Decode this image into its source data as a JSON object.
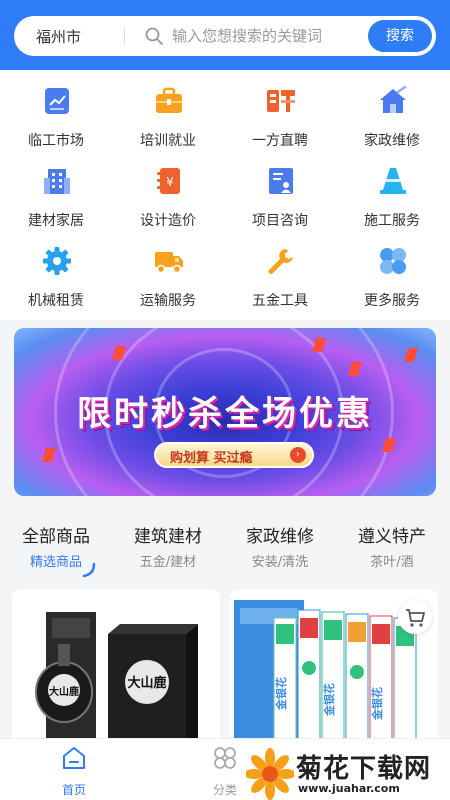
{
  "search": {
    "city": "福州市",
    "placeholder": "输入您想搜索的关键词",
    "button_label": "搜索"
  },
  "categories": [
    {
      "label": "临工市场",
      "icon": "chart-doc-icon"
    },
    {
      "label": "培训就业",
      "icon": "briefcase-icon"
    },
    {
      "label": "一方直聘",
      "icon": "recruit-icon"
    },
    {
      "label": "家政维修",
      "icon": "home-clean-icon"
    },
    {
      "label": "建材家居",
      "icon": "building-icon"
    },
    {
      "label": "设计造价",
      "icon": "price-book-icon"
    },
    {
      "label": "项目咨询",
      "icon": "consult-icon"
    },
    {
      "label": "施工服务",
      "icon": "traffic-cone-icon"
    },
    {
      "label": "机械租赁",
      "icon": "gear-icon"
    },
    {
      "label": "运输服务",
      "icon": "truck-icon"
    },
    {
      "label": "五金工具",
      "icon": "wrench-icon"
    },
    {
      "label": "更多服务",
      "icon": "grid-more-icon"
    }
  ],
  "banner": {
    "title": "限时秒杀全场优惠",
    "button_label": "购划算 买过瘾"
  },
  "tabs": [
    {
      "title": "全部商品",
      "sub": "精选商品"
    },
    {
      "title": "建筑建材",
      "sub": "五金/建材"
    },
    {
      "title": "家政维修",
      "sub": "安装/清洗"
    },
    {
      "title": "遵义特产",
      "sub": "茶叶/酒"
    }
  ],
  "products": [
    {
      "brand_text": "大山鹿",
      "icon": "liquor-bottle-image"
    },
    {
      "brand_text": "金银花",
      "icon": "toothpaste-image"
    }
  ],
  "bottom_nav": [
    {
      "label": "首页",
      "icon": "home-icon"
    },
    {
      "label": "分类",
      "icon": "category-icon"
    }
  ],
  "watermark": {
    "title": "菊花下载网",
    "url": "www.juahar.com"
  },
  "colors": {
    "primary": "#2e7cf6",
    "orange": "#f7a21c",
    "cone": "#27b2f0"
  }
}
